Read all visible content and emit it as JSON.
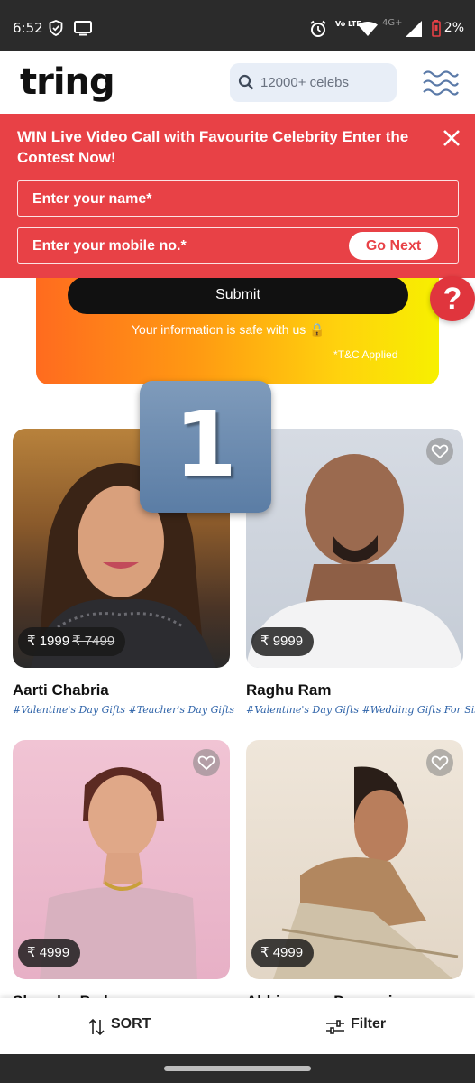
{
  "status_bar": {
    "time": "6:52",
    "network": "4G+",
    "volte": "Vo LTE",
    "battery": "2%",
    "icons": [
      "shield-icon",
      "screen-icon",
      "alarm-icon",
      "volte-icon",
      "wifi-icon",
      "signal-icon",
      "battery-low-icon"
    ]
  },
  "header": {
    "logo": "tring",
    "search_placeholder": "12000+ celebs",
    "menu_icon": "wave-menu-icon"
  },
  "banner": {
    "title": "WIN Live Video Call with Favourite Celebrity Enter the Contest Now!",
    "name_placeholder": "Enter your name*",
    "mobile_placeholder": "Enter your mobile no.*",
    "go_next": "Go Next",
    "bg_color": "#e84146"
  },
  "promo": {
    "submit": "Submit",
    "safe_text": "Your information is safe with us",
    "tc": "*T&C Applied"
  },
  "help_label": "?",
  "badge_number": "1",
  "cards": [
    {
      "name": "Aarti Chabria",
      "price": "₹ 1999",
      "old_price": "₹ 7499",
      "tags": "#Valentine's Day Gifts #Teacher's Day Gifts"
    },
    {
      "name": "Raghu Ram",
      "price": "₹ 9999",
      "old_price": "",
      "tags": "#Valentine's Day Gifts #Wedding Gifts For Sister"
    },
    {
      "name": "Shazahn Padamsee",
      "price": "₹ 4999",
      "old_price": "",
      "tags": ""
    },
    {
      "name": "Abhimanyu Dassani",
      "price": "₹ 4999",
      "old_price": "",
      "tags": ""
    }
  ],
  "bottom_bar": {
    "sort": "SORT",
    "filter": "Filter"
  }
}
